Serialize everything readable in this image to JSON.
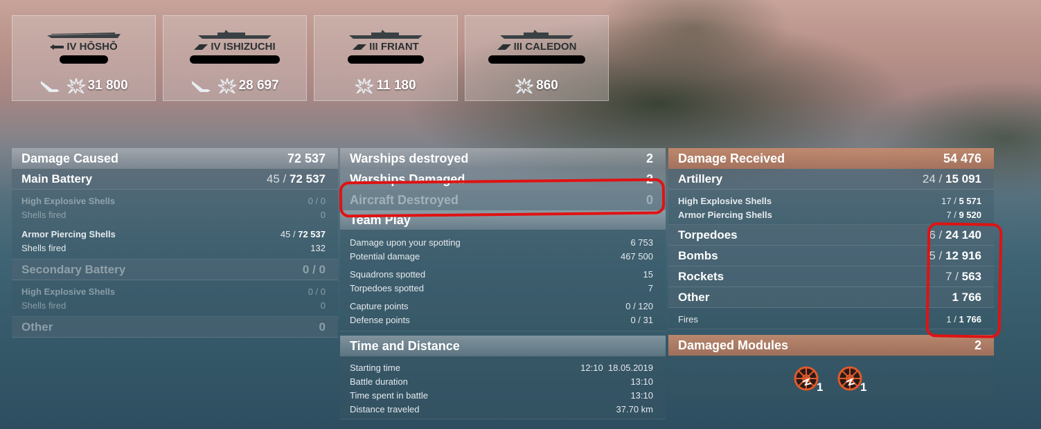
{
  "ships": [
    {
      "tier": "IV",
      "name": "HŌSHŌ",
      "damage": "31 800"
    },
    {
      "tier": "IV",
      "name": "ISHIZUCHI",
      "damage": "28 697"
    },
    {
      "tier": "III",
      "name": "FRIANT",
      "damage": "11 180"
    },
    {
      "tier": "III",
      "name": "CALEDON",
      "damage": "860"
    }
  ],
  "damage_caused": {
    "title": "Damage Caused",
    "total": "72 537",
    "main_battery": {
      "label": "Main Battery",
      "hits": "45",
      "damage": "72 537"
    },
    "mb_he": {
      "label": "High Explosive Shells",
      "hits": "0",
      "damage": "0"
    },
    "mb_he_fired": {
      "label": "Shells fired",
      "value": "0"
    },
    "mb_ap": {
      "label": "Armor Piercing Shells",
      "hits": "45",
      "damage": "72 537"
    },
    "mb_ap_fired": {
      "label": "Shells fired",
      "value": "132"
    },
    "secondary": {
      "label": "Secondary Battery",
      "hits": "0",
      "damage": "0"
    },
    "sb_he": {
      "label": "High Explosive Shells",
      "hits": "0",
      "damage": "0"
    },
    "sb_he_fired": {
      "label": "Shells fired",
      "value": "0"
    },
    "other": {
      "label": "Other",
      "value": "0"
    }
  },
  "middle": {
    "warships_destroyed": {
      "label": "Warships destroyed",
      "value": "2"
    },
    "warships_damaged": {
      "label": "Warships Damaged",
      "value": "2"
    },
    "aircraft_destroyed": {
      "label": "Aircraft Destroyed",
      "value": "0"
    },
    "team_play": {
      "title": "Team Play",
      "rows": [
        {
          "label": "Damage upon your spotting",
          "value": "6 753"
        },
        {
          "label": "Potential damage",
          "value": "467 500"
        },
        {
          "label": "Squadrons spotted",
          "value": "15"
        },
        {
          "label": "Torpedoes spotted",
          "value": "7"
        },
        {
          "label": "Capture points",
          "value": "0 / 120"
        },
        {
          "label": "Defense points",
          "value": "0 / 31"
        }
      ]
    },
    "time_distance": {
      "title": "Time and Distance",
      "rows": [
        {
          "label": "Starting time",
          "value": "12:10  18.05.2019"
        },
        {
          "label": "Battle duration",
          "value": "13:10"
        },
        {
          "label": "Time spent in battle",
          "value": "13:10"
        },
        {
          "label": "Distance traveled",
          "value": "37.70 km"
        }
      ]
    }
  },
  "damage_received": {
    "title": "Damage Received",
    "total": "54 476",
    "artillery": {
      "label": "Artillery",
      "hits": "24",
      "damage": "15 091"
    },
    "art_he": {
      "label": "High Explosive Shells",
      "hits": "17",
      "damage": "5 571"
    },
    "art_ap": {
      "label": "Armor Piercing Shells",
      "hits": "7",
      "damage": "9 520"
    },
    "torpedoes": {
      "label": "Torpedoes",
      "hits": "6",
      "damage": "24 140"
    },
    "bombs": {
      "label": "Bombs",
      "hits": "5",
      "damage": "12 916"
    },
    "rockets": {
      "label": "Rockets",
      "hits": "7",
      "damage": "563"
    },
    "other": {
      "label": "Other",
      "damage": "1 766"
    },
    "fires": {
      "label": "Fires",
      "hits": "1",
      "damage": "1 766"
    }
  },
  "damaged_modules": {
    "title": "Damaged Modules",
    "total": "2",
    "modules": [
      {
        "count": "1"
      },
      {
        "count": "1"
      }
    ]
  },
  "colors": {
    "annotation": "#e01212",
    "received_header": "#c88c6e"
  }
}
